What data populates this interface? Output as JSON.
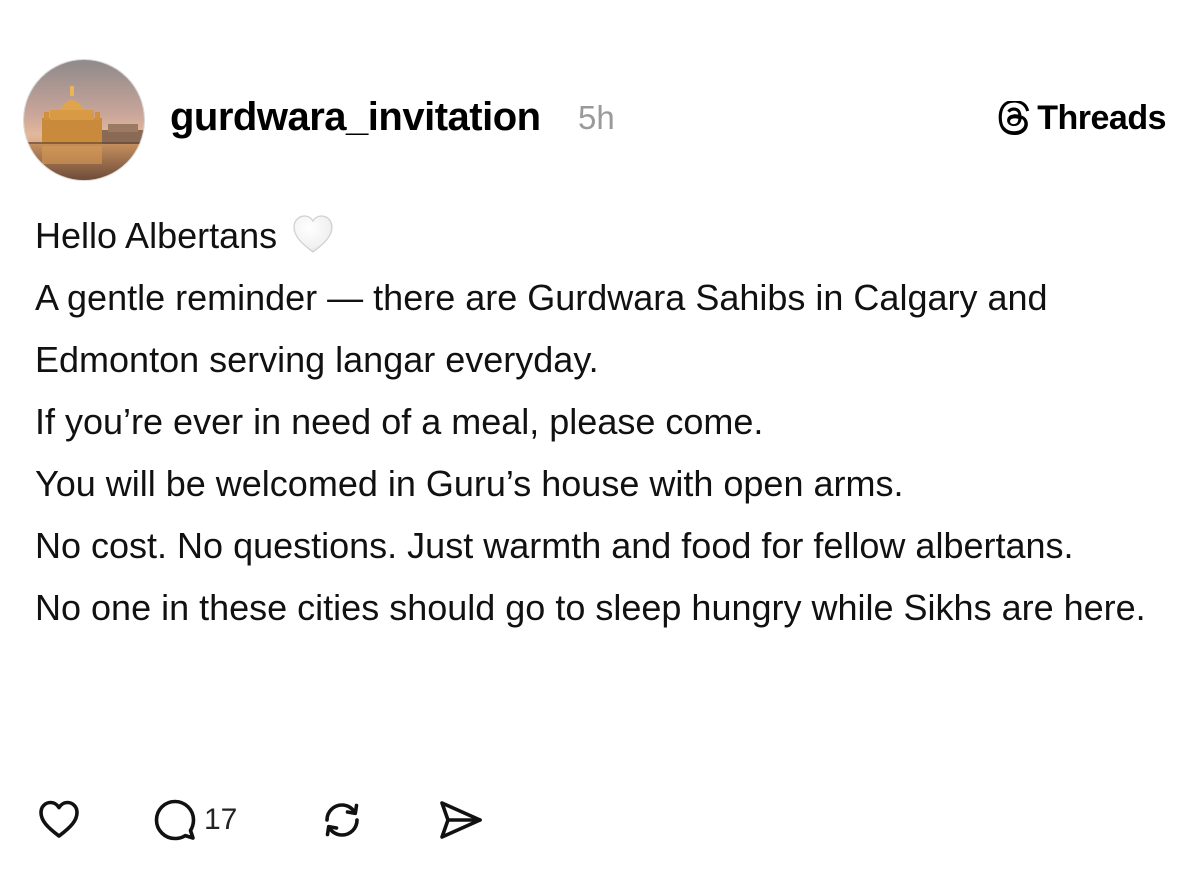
{
  "post": {
    "username": "gurdwara_invitation",
    "timestamp": "5h",
    "brand_label": "Threads",
    "paragraphs": [
      "Hello Albertans",
      "A gentle reminder — there are Gurdwara Sahibs in Calgary and Edmonton serving langar everyday.",
      "If you’re ever in need of a meal, please come.",
      "You will be welcomed in Guru’s house with open arms.",
      "No cost. No questions. Just warmth and food for fellow albertans.",
      "No one in these cities should go to sleep hungry while Sikhs are here."
    ],
    "reply_count": "17"
  },
  "icons": {
    "avatar": "golden-temple-photo",
    "brand": "threads-logo-icon",
    "emoji": "white-heart-emoji",
    "like": "heart-outline-icon",
    "reply": "speech-bubble-icon",
    "repost": "repost-arrows-icon",
    "share": "send-paper-plane-icon"
  },
  "colors": {
    "text": "#111111",
    "muted": "#9a9a9a",
    "background": "#ffffff"
  }
}
